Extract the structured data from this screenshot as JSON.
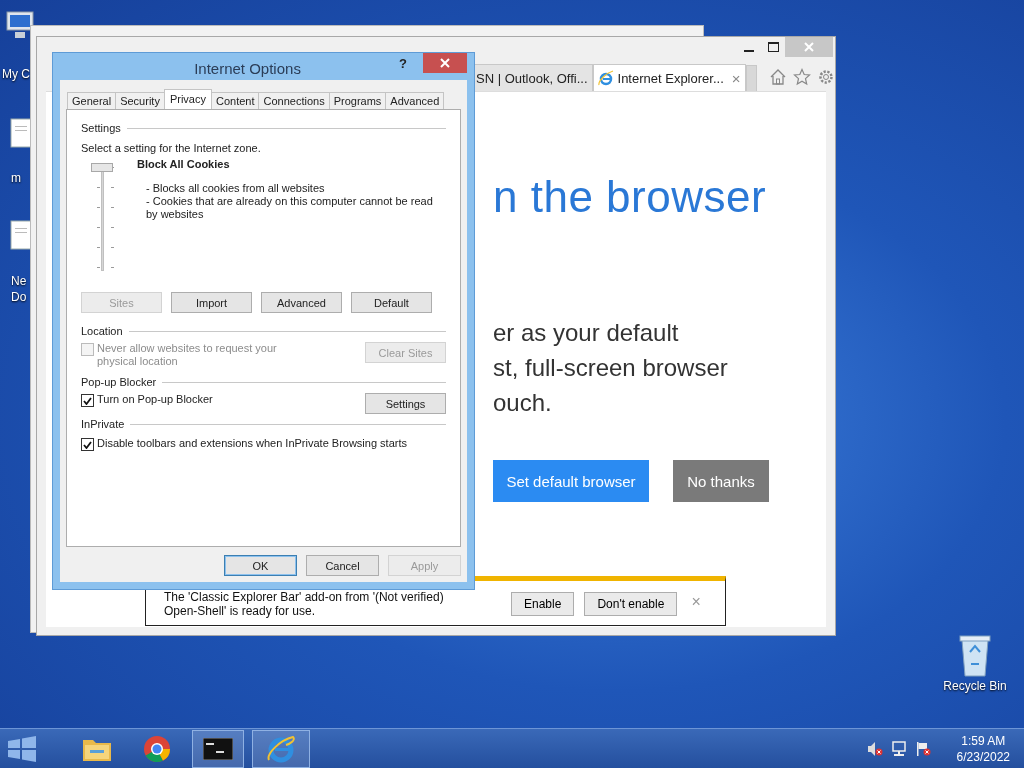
{
  "desktop_icons": [
    {
      "kind": "computer",
      "label": "My C"
    },
    {
      "kind": "document",
      "label": "m"
    },
    {
      "kind": "document",
      "label": "Ne\nDo"
    }
  ],
  "recycle_bin": {
    "label": "Recycle Bin"
  },
  "browser": {
    "tabs": [
      {
        "label": "SN | Outlook, Offi...",
        "selected": false
      },
      {
        "label": "Internet Explorer...",
        "selected": true,
        "close": "×"
      }
    ],
    "headline": "n the browser",
    "body_lines": [
      "er as your default",
      "st, full-screen browser",
      "ouch."
    ],
    "buttons": [
      {
        "label": "Set default browser",
        "kind": "primary"
      },
      {
        "label": "No thanks",
        "kind": "secondary"
      }
    ],
    "notification": {
      "lines": [
        "The 'Classic Explorer Bar' add-on from '(Not verified)",
        "Open-Shell' is ready for use."
      ],
      "buttons": [
        "Enable",
        "Don't enable"
      ],
      "close": "×"
    }
  },
  "dialog": {
    "title": "Internet Options",
    "help": "?",
    "tabs": [
      {
        "label": "General",
        "selected": false
      },
      {
        "label": "Security",
        "selected": false
      },
      {
        "label": "Privacy",
        "selected": true
      },
      {
        "label": "Content",
        "selected": false
      },
      {
        "label": "Connections",
        "selected": false
      },
      {
        "label": "Programs",
        "selected": false
      },
      {
        "label": "Advanced",
        "selected": false
      }
    ],
    "settings": {
      "heading": "Settings",
      "prompt": "Select a setting for the Internet zone.",
      "level": 1,
      "level_name": "Block All Cookies",
      "description": [
        "- Blocks all cookies from all websites",
        "- Cookies that are already on this computer cannot be read by websites"
      ],
      "buttons": [
        {
          "label": "Sites",
          "disabled": true
        },
        {
          "label": "Import",
          "disabled": false
        },
        {
          "label": "Advanced",
          "disabled": false
        },
        {
          "label": "Default",
          "disabled": false
        }
      ]
    },
    "location": {
      "heading": "Location",
      "checkbox": {
        "label": "Never allow websites to request your physical location",
        "checked": false,
        "disabled": true
      },
      "button": {
        "label": "Clear Sites",
        "disabled": true
      }
    },
    "popup": {
      "heading": "Pop-up Blocker",
      "checkbox": {
        "label": "Turn on Pop-up Blocker",
        "checked": true,
        "disabled": false
      },
      "button": {
        "label": "Settings",
        "disabled": false
      }
    },
    "inprivate": {
      "heading": "InPrivate",
      "checkbox": {
        "label": "Disable toolbars and extensions when InPrivate Browsing starts",
        "checked": true,
        "disabled": false
      }
    },
    "footer_buttons": [
      {
        "label": "OK",
        "disabled": false,
        "default": true
      },
      {
        "label": "Cancel",
        "disabled": false,
        "default": false
      },
      {
        "label": "Apply",
        "disabled": true,
        "default": false
      }
    ]
  },
  "taskbar": {
    "apps": [
      {
        "kind": "folder",
        "active": false
      },
      {
        "kind": "chrome",
        "active": false
      },
      {
        "kind": "console",
        "active": true
      },
      {
        "kind": "ie",
        "active": true
      }
    ],
    "time": "1:59 AM",
    "date": "6/23/2022"
  }
}
